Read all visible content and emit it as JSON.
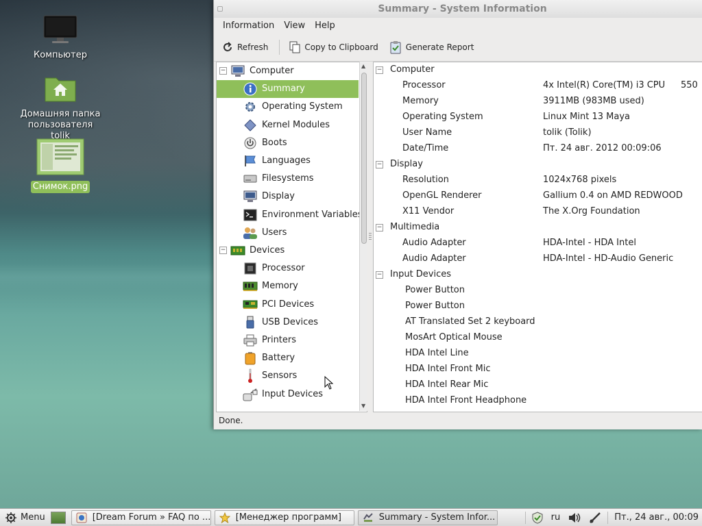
{
  "desktop": {
    "icons": [
      {
        "label": "Компьютер"
      },
      {
        "label": "Домашняя папка пользователя tolik"
      },
      {
        "label": "Снимок.png"
      }
    ]
  },
  "window": {
    "title": "Summary - System Information",
    "menu": [
      "Information",
      "View",
      "Help"
    ],
    "toolbar": {
      "refresh": "Refresh",
      "copy": "Copy to Clipboard",
      "report": "Generate Report"
    },
    "tree": [
      {
        "label": "Computer",
        "level": 0,
        "icon": "computer-icon"
      },
      {
        "label": "Summary",
        "level": 1,
        "icon": "info-icon",
        "selected": true
      },
      {
        "label": "Operating System",
        "level": 1,
        "icon": "gear-icon"
      },
      {
        "label": "Kernel Modules",
        "level": 1,
        "icon": "module-icon"
      },
      {
        "label": "Boots",
        "level": 1,
        "icon": "power-icon"
      },
      {
        "label": "Languages",
        "level": 1,
        "icon": "flag-icon"
      },
      {
        "label": "Filesystems",
        "level": 1,
        "icon": "drive-icon"
      },
      {
        "label": "Display",
        "level": 1,
        "icon": "monitor-icon"
      },
      {
        "label": "Environment Variables",
        "level": 1,
        "icon": "terminal-icon"
      },
      {
        "label": "Users",
        "level": 1,
        "icon": "users-icon"
      },
      {
        "label": "Devices",
        "level": 0,
        "icon": "chip-icon"
      },
      {
        "label": "Processor",
        "level": 1,
        "icon": "cpu-icon"
      },
      {
        "label": "Memory",
        "level": 1,
        "icon": "memory-icon"
      },
      {
        "label": "PCI Devices",
        "level": 1,
        "icon": "pci-icon"
      },
      {
        "label": "USB Devices",
        "level": 1,
        "icon": "usb-icon"
      },
      {
        "label": "Printers",
        "level": 1,
        "icon": "printer-icon"
      },
      {
        "label": "Battery",
        "level": 1,
        "icon": "battery-icon"
      },
      {
        "label": "Sensors",
        "level": 1,
        "icon": "thermometer-icon"
      },
      {
        "label": "Input Devices",
        "level": 1,
        "icon": "input-icon"
      }
    ],
    "summary": [
      {
        "type": "section",
        "label": "Computer"
      },
      {
        "type": "item",
        "key": "Processor",
        "value": "4x Intel(R) Core(TM) i3 CPU",
        "value2": "550"
      },
      {
        "type": "item",
        "key": "Memory",
        "value": "3911MB (983MB used)"
      },
      {
        "type": "item",
        "key": "Operating System",
        "value": "Linux Mint 13 Maya"
      },
      {
        "type": "item",
        "key": "User Name",
        "value": "tolik (Tolik)"
      },
      {
        "type": "item",
        "key": "Date/Time",
        "value": "Пт. 24 авг. 2012 00:09:06"
      },
      {
        "type": "section",
        "label": "Display"
      },
      {
        "type": "item",
        "key": "Resolution",
        "value": "1024x768 pixels"
      },
      {
        "type": "item",
        "key": "OpenGL Renderer",
        "value": "Gallium 0.4 on AMD REDWOOD"
      },
      {
        "type": "item",
        "key": "X11 Vendor",
        "value": "The X.Org Foundation"
      },
      {
        "type": "section",
        "label": "Multimedia"
      },
      {
        "type": "item",
        "key": "Audio Adapter",
        "value": "HDA-Intel - HDA Intel"
      },
      {
        "type": "item",
        "key": "Audio Adapter",
        "value": "HDA-Intel - HD-Audio Generic"
      },
      {
        "type": "section",
        "label": "Input Devices"
      },
      {
        "type": "device",
        "key": "Power Button"
      },
      {
        "type": "device",
        "key": "Power Button"
      },
      {
        "type": "device",
        "key": "AT Translated Set 2 keyboard"
      },
      {
        "type": "device",
        "key": "MosArt Optical Mouse"
      },
      {
        "type": "device",
        "key": "HDA Intel Line"
      },
      {
        "type": "device",
        "key": "HDA Intel Front Mic"
      },
      {
        "type": "device",
        "key": "HDA Intel Rear Mic"
      },
      {
        "type": "device",
        "key": "HDA Intel Front Headphone"
      }
    ],
    "status": "Done."
  },
  "taskbar": {
    "menu_label": "Menu",
    "tasks": [
      {
        "label": "[Dream Forum » FAQ по ...",
        "icon": "browser-icon"
      },
      {
        "label": "[Менеджер программ]",
        "icon": "star-icon"
      },
      {
        "label": "Summary - System Infor...",
        "icon": "sysinfo-icon",
        "active": true
      }
    ],
    "tray": {
      "keyboard_layout": "ru",
      "clock": "Пт., 24 авг., 00:09"
    }
  },
  "colors": {
    "selection": "#8fbf5a",
    "window_bg": "#edeceb"
  }
}
